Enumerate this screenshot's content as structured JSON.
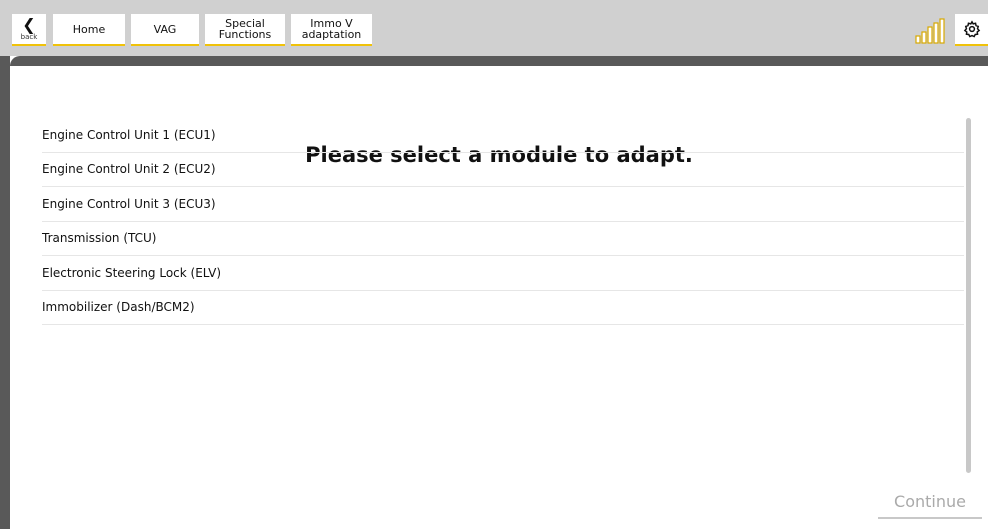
{
  "toolbar": {
    "back_label": "back",
    "breadcrumbs": [
      {
        "label": "Home"
      },
      {
        "label": "VAG"
      },
      {
        "label": "Special\nFunctions"
      },
      {
        "label": "Immo V\nadaptation"
      }
    ],
    "icons": {
      "back": "chevron-left-icon",
      "signal": "signal-strength-icon",
      "settings": "gear-icon"
    }
  },
  "main": {
    "prompt": "Please select a module to adapt.",
    "modules": [
      {
        "label": "Engine Control Unit 1 (ECU1)"
      },
      {
        "label": "Engine Control Unit 2 (ECU2)"
      },
      {
        "label": "Engine Control Unit 3 (ECU3)"
      },
      {
        "label": "Transmission (TCU)"
      },
      {
        "label": "Electronic Steering Lock (ELV)"
      },
      {
        "label": "Immobilizer (Dash/BCM2)"
      }
    ],
    "continue_label": "Continue"
  },
  "colors": {
    "accent": "#f0c20a",
    "toolbar_bg": "#d0d0d0",
    "frame": "#595959",
    "disabled_text": "#aaaaaa"
  }
}
